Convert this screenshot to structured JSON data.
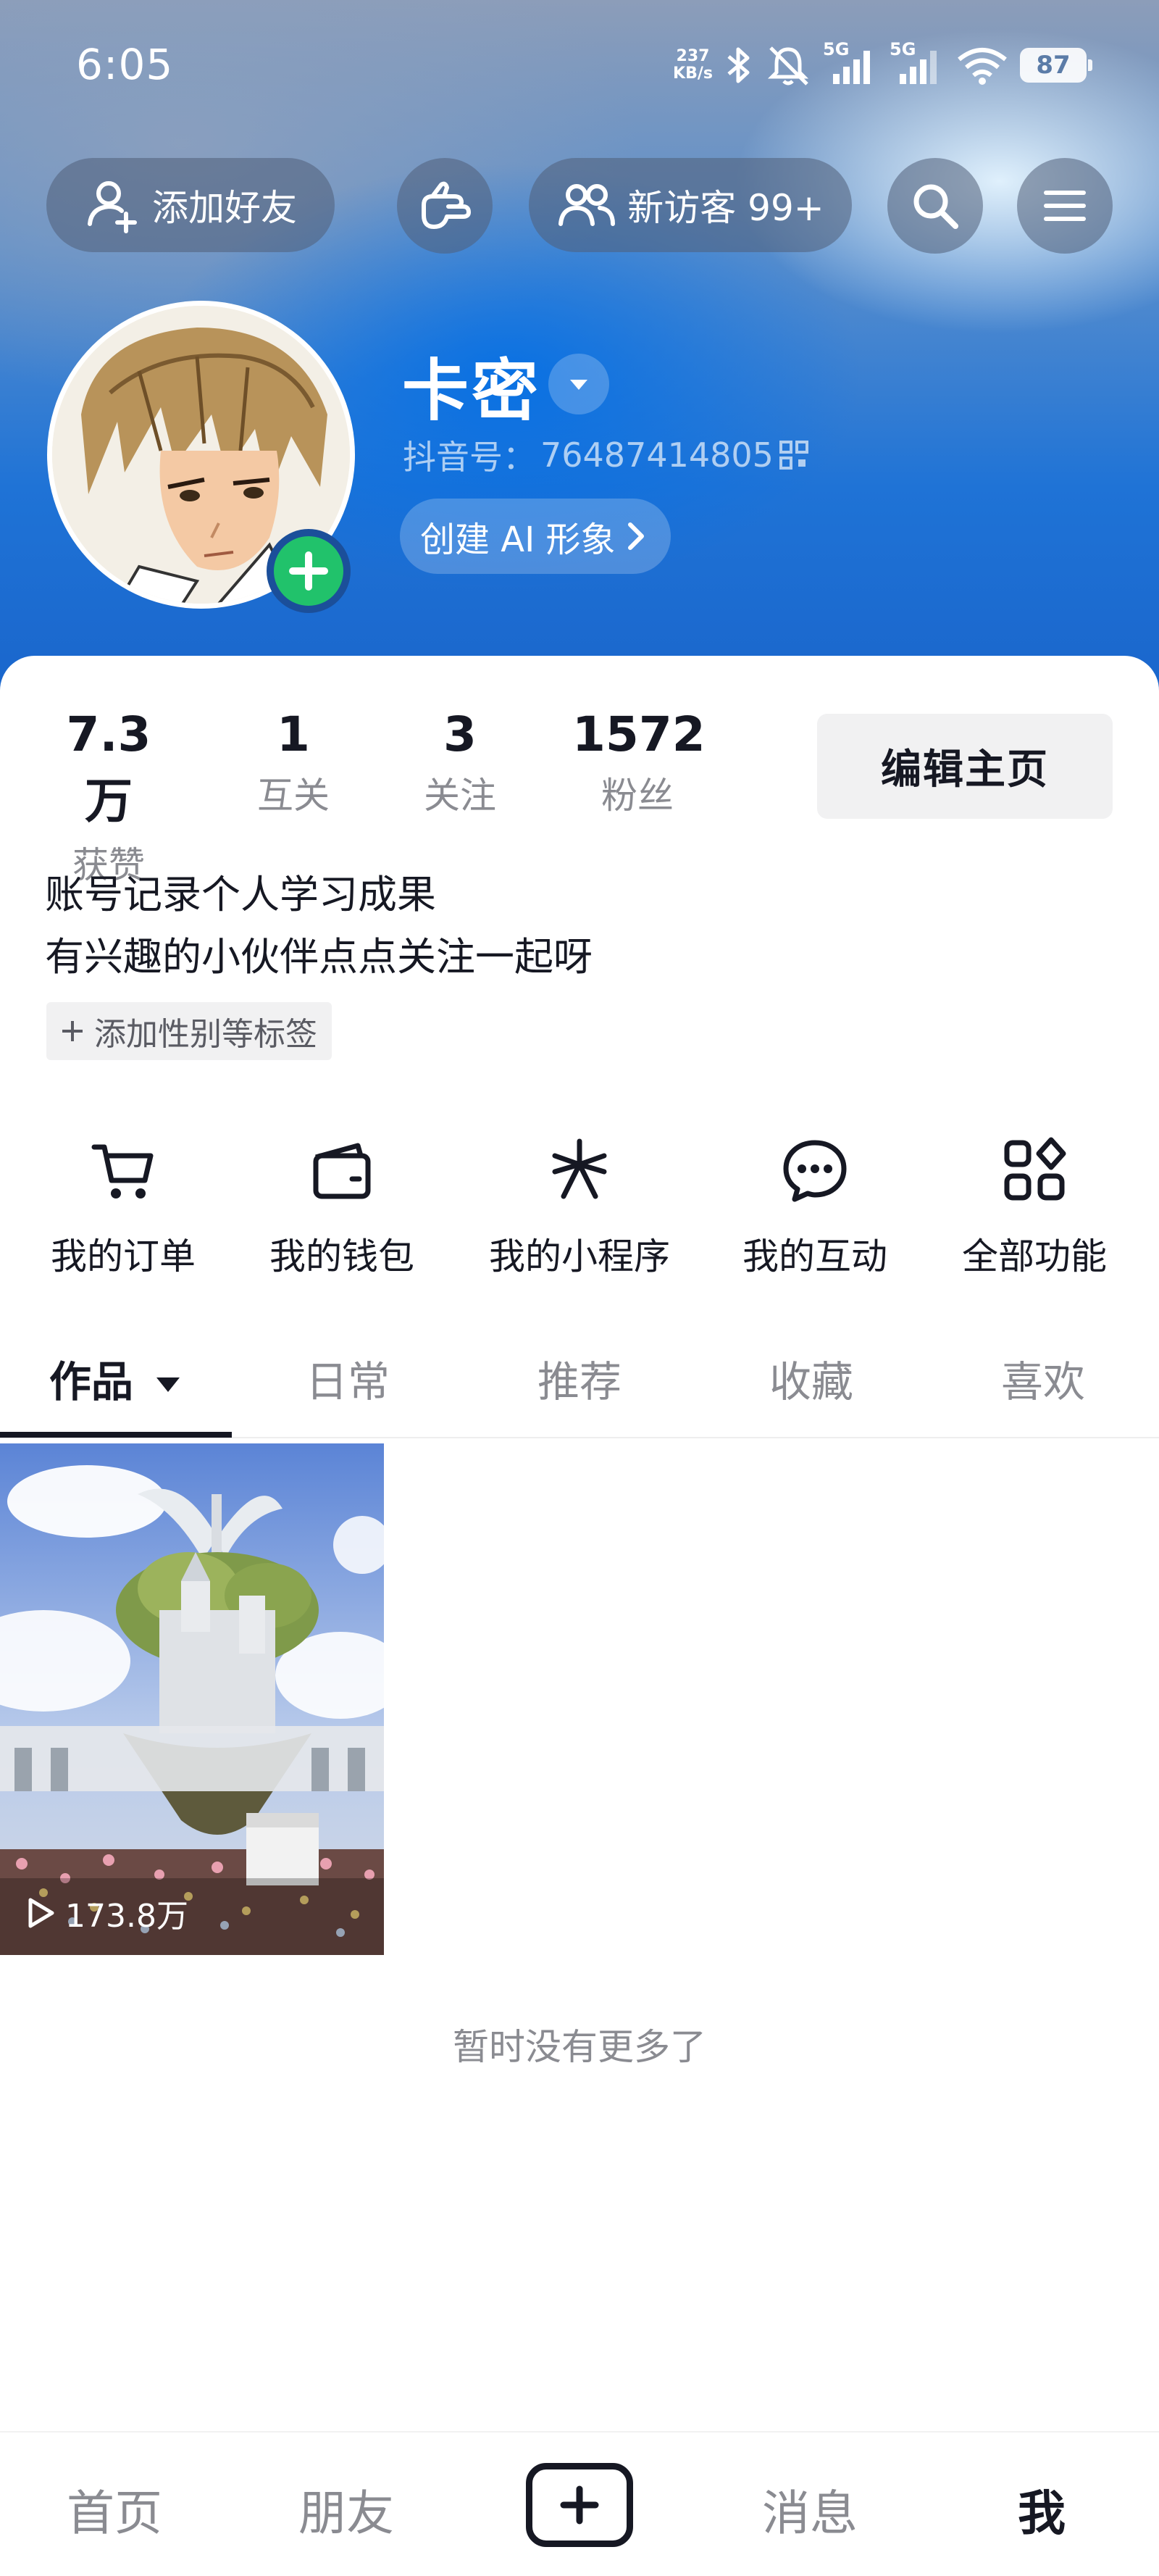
{
  "status_bar": {
    "time": "6:05",
    "net_speed_value": "237",
    "net_speed_unit": "KB/s",
    "signal_1_label": "5G",
    "signal_2_label": "5G",
    "battery": "87"
  },
  "top_actions": {
    "add_friend_label": "添加好友",
    "visitors_label": "新访客 99+"
  },
  "profile": {
    "name": "卡密",
    "douyin_id_label": "抖音号：",
    "douyin_id": "76487414805",
    "ai_avatar_label": "创建 AI 形象"
  },
  "stats": [
    {
      "value": "7.3万",
      "label": "获赞"
    },
    {
      "value": "1",
      "label": "互关"
    },
    {
      "value": "3",
      "label": "关注"
    },
    {
      "value": "1572",
      "label": "粉丝"
    }
  ],
  "edit_profile_label": "编辑主页",
  "bio": {
    "line1": "账号记录个人学习成果",
    "line2": "有兴趣的小伙伴点点关注一起呀"
  },
  "add_tags_label": "添加性别等标签",
  "features": [
    {
      "label": "我的订单",
      "icon": "cart-icon"
    },
    {
      "label": "我的钱包",
      "icon": "wallet-icon"
    },
    {
      "label": "我的小程序",
      "icon": "mini-program-icon"
    },
    {
      "label": "我的互动",
      "icon": "chat-icon"
    },
    {
      "label": "全部功能",
      "icon": "grid-icon"
    }
  ],
  "tabs": [
    {
      "label": "作品",
      "active": true
    },
    {
      "label": "日常",
      "active": false
    },
    {
      "label": "推荐",
      "active": false
    },
    {
      "label": "收藏",
      "active": false
    },
    {
      "label": "喜欢",
      "active": false
    }
  ],
  "videos": [
    {
      "play_count": "173.8万"
    }
  ],
  "no_more_text": "暂时没有更多了",
  "bottom_nav": {
    "home": "首页",
    "friends": "朋友",
    "messages": "消息",
    "me": "我"
  },
  "colors": {
    "accent_green": "#21c26b",
    "header_blue": "#1f73d6",
    "text_primary": "#161823",
    "text_secondary": "#8a8b91"
  }
}
